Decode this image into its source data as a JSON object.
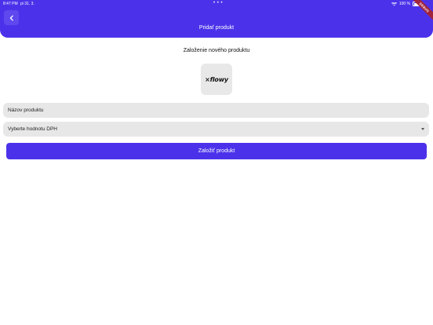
{
  "status_bar": {
    "time": "8:47 PM",
    "date": "pi 31. 3.",
    "dots": "• • •",
    "battery": "100 %"
  },
  "debug_ribbon": "DEBUG",
  "app_bar": {
    "title": "Pridať produkt"
  },
  "main": {
    "heading": "Založenie nového produktu",
    "logo_text": "×flowy",
    "name_field_placeholder": "Názov produktu",
    "vat_select_label": "Vyberte hodnotu DPH",
    "submit_label": "Založiť produkt"
  },
  "colors": {
    "primary": "#4b32ea",
    "field_bg": "#e7e7e7",
    "background": "#ffffff"
  },
  "icons": {
    "back": "chevron-left-icon",
    "dropdown": "caret-down-icon",
    "wifi": "wifi-icon",
    "battery": "battery-icon"
  }
}
